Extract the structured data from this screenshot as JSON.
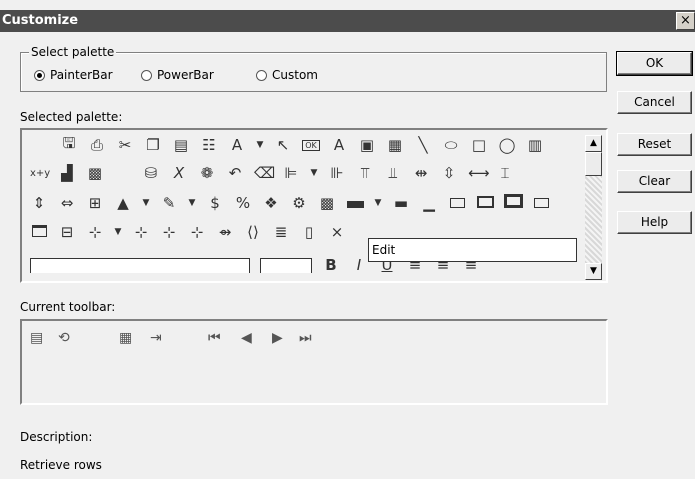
{
  "window": {
    "title": "Customize",
    "close_glyph": "×"
  },
  "select_palette": {
    "legend": "Select palette",
    "options": [
      {
        "label": "PainterBar",
        "selected": true
      },
      {
        "label": "PowerBar",
        "selected": false
      },
      {
        "label": "Custom",
        "selected": false
      }
    ]
  },
  "selected_palette": {
    "label": "Selected palette:",
    "edit_field_value": "Edit",
    "icons_row1": [
      "save",
      "print",
      "cut",
      "copy",
      "paste",
      "properties",
      "text-color",
      "arrow",
      "pointer",
      "ok-button",
      "static-text",
      "picture",
      "picture-button",
      "line",
      "oval",
      "rectangle",
      "round-rectangle",
      "columns"
    ],
    "icons_row2": [
      "expression",
      "graph",
      "ole",
      "database",
      "computed-field",
      "report",
      "undo",
      "eraser",
      "align-left",
      "align-right",
      "align-top",
      "align-bottom",
      "space-horz",
      "space-vert",
      "size-width",
      "size-height"
    ],
    "icons_row3": [
      "vertical-size",
      "horizontal-size",
      "grid",
      "fill",
      "border",
      "currency",
      "percent",
      "layer",
      "debug",
      "preview",
      "border-box",
      "border-line",
      "border-rect",
      "border-raised",
      "border-shadow",
      "border-lowered"
    ],
    "icons_row4": [
      "tab-order",
      "dropdown",
      "align-center",
      "align-vcenter",
      "align-hcenter",
      "group",
      "slider",
      "datawindow",
      "report-obj",
      "close",
      "edit-field"
    ]
  },
  "current_toolbar": {
    "label": "Current toolbar:",
    "icons": [
      "retrieve",
      "update",
      "save-rows",
      "insert-row",
      "first",
      "prior",
      "next",
      "last"
    ]
  },
  "description": {
    "label": "Description:",
    "text": "Retrieve rows"
  },
  "buttons": {
    "ok": "OK",
    "cancel": "Cancel",
    "reset": "Reset",
    "clear": "Clear",
    "help": "Help"
  },
  "glyphs": {
    "scroll_up": "▲",
    "scroll_down": "▼"
  }
}
